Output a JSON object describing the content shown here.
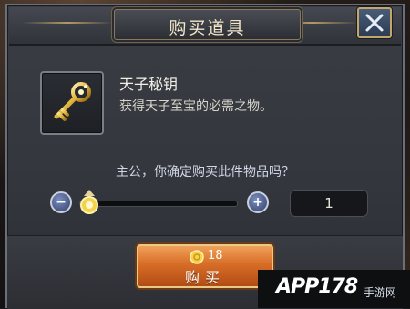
{
  "dialog": {
    "title": "购买道具"
  },
  "item": {
    "name": "天子秘钥",
    "description": "获得天子至宝的必需之物。",
    "icon": "golden-key-icon"
  },
  "purchase": {
    "confirm_prompt": "主公，你确定购买此件物品吗？",
    "quantity": "1",
    "slider_fraction": 0,
    "price": "18",
    "buy_label": "购买"
  },
  "watermark": {
    "text": "APP178",
    "sub": "手游网"
  },
  "colors": {
    "accent_gold": "#c3a66b",
    "buy_orange": "#d76d27",
    "close_blue": "#2b3b52"
  }
}
